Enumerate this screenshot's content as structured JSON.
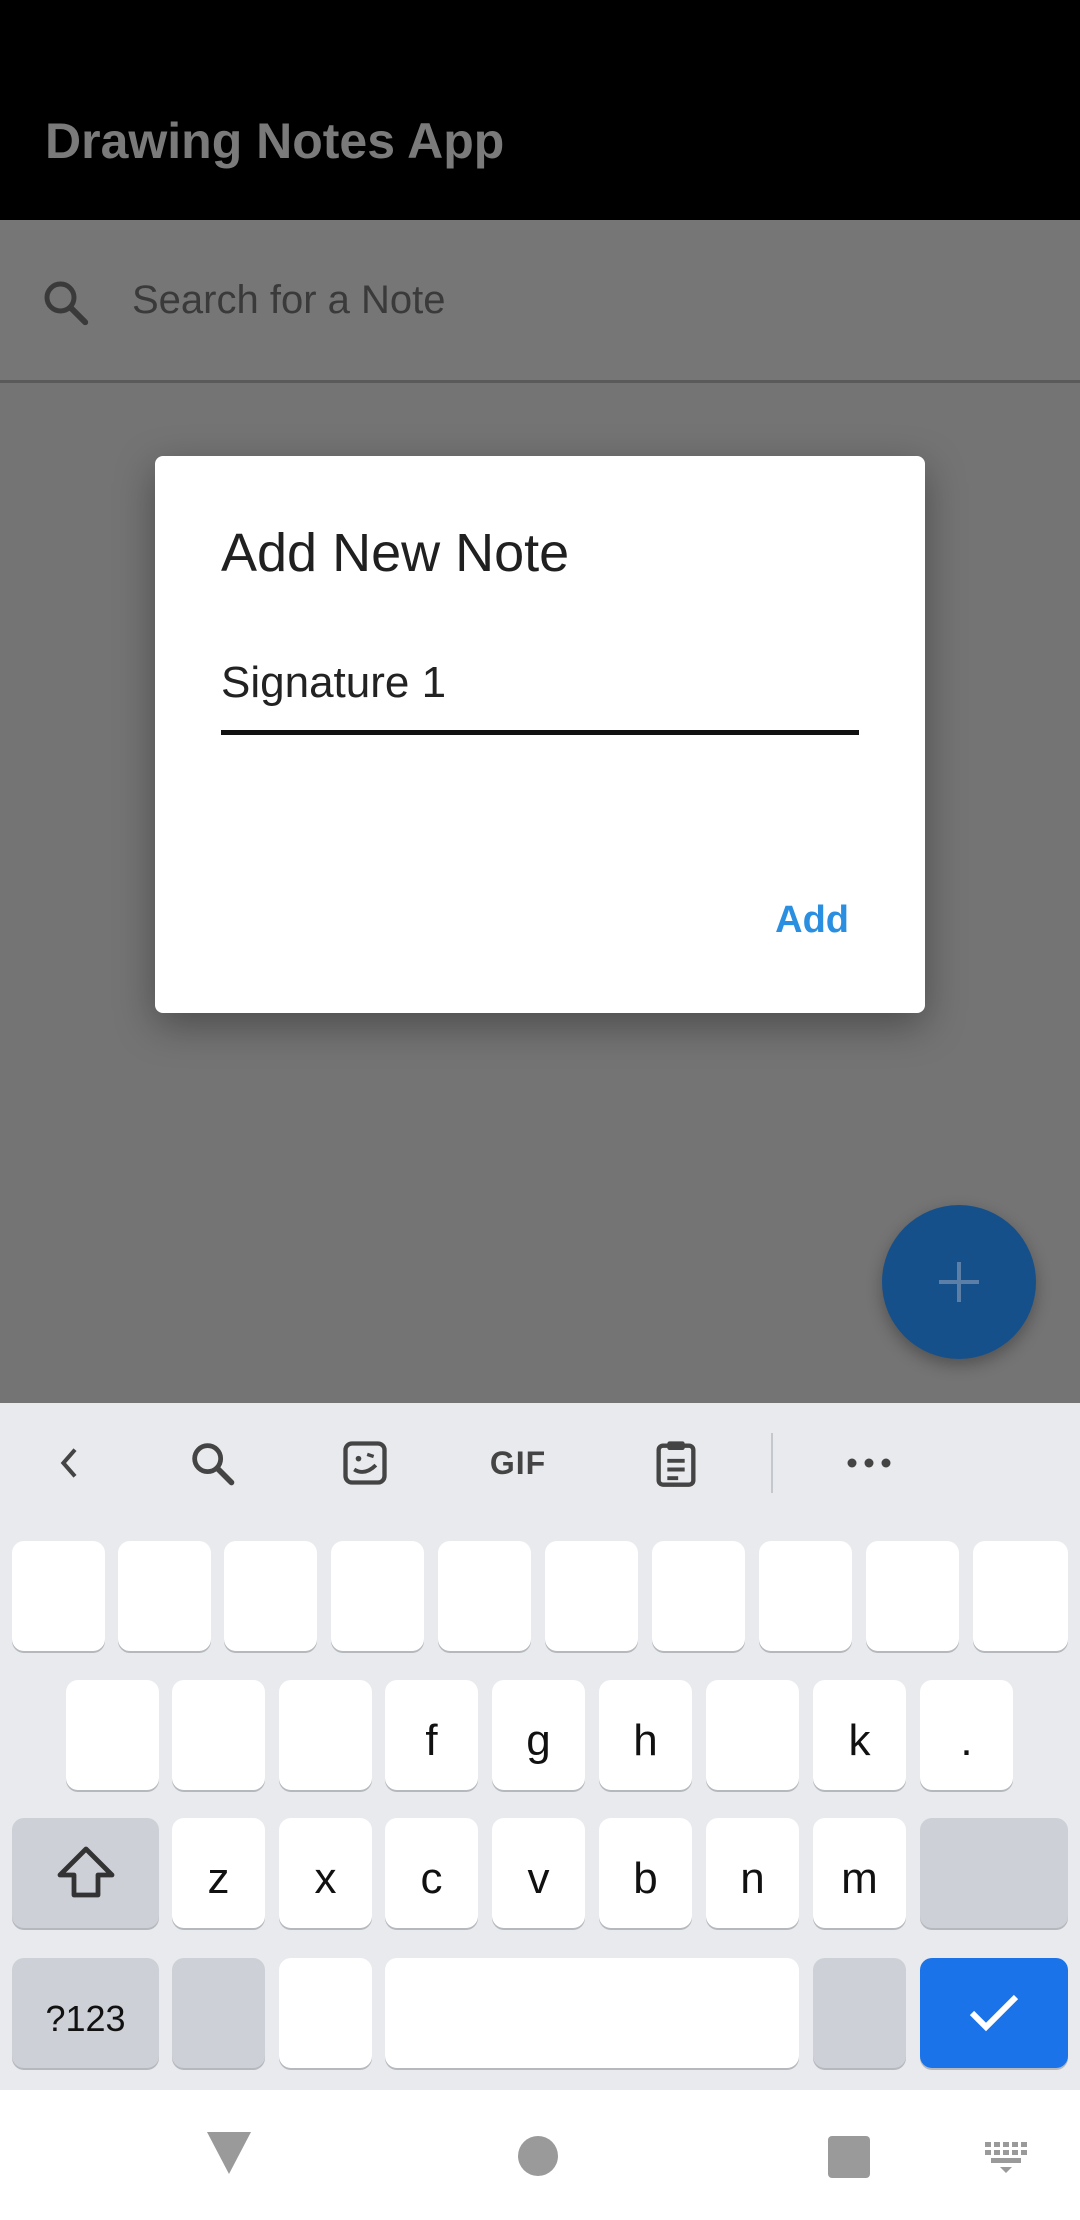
{
  "app": {
    "title": "Drawing Notes App"
  },
  "search": {
    "placeholder": "Search for a Note",
    "icon": "search-icon"
  },
  "dialog": {
    "title": "Add New Note",
    "note_value": "Signature 1",
    "add_label": "Add"
  },
  "fab": {
    "icon": "plus-icon"
  },
  "keyboard": {
    "toolbar": {
      "gif_label": "GIF",
      "icons": [
        "chevron-left-icon",
        "search-icon",
        "sticker-icon",
        "gif-icon",
        "clipboard-icon",
        "more-icon"
      ]
    },
    "row2_keys": [
      "",
      "",
      "",
      "f",
      "g",
      "h",
      "",
      "k",
      "."
    ],
    "row3_keys": [
      "z",
      "x",
      "c",
      "v",
      "b",
      "n",
      "m"
    ],
    "symbols_label": "?123"
  },
  "colors": {
    "accent": "#2a8fe0",
    "fab": "#16508a",
    "enter_key": "#1a73e8",
    "scrim": "#747474"
  }
}
